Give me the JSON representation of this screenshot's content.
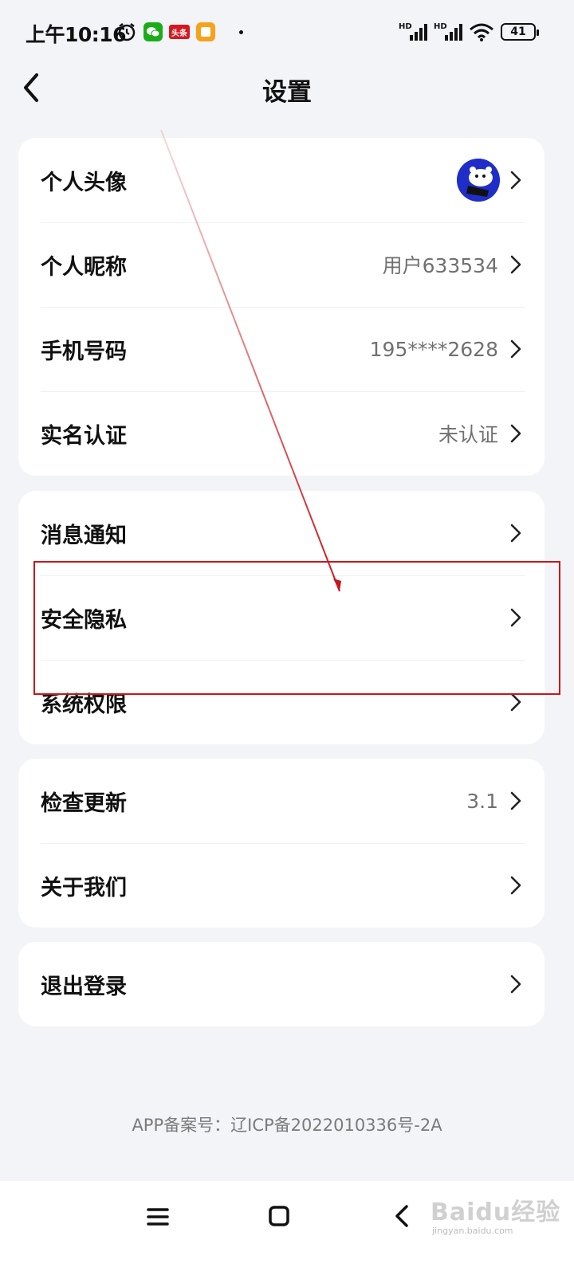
{
  "status_bar": {
    "time": "上午10:16",
    "toutiao_label": "头条",
    "battery": "41",
    "signal_label": "HD"
  },
  "nav": {
    "title": "设置"
  },
  "groups": [
    {
      "rows": [
        {
          "label": "个人头像",
          "value": ""
        },
        {
          "label": "个人昵称",
          "value": "用户633534"
        },
        {
          "label": "手机号码",
          "value": "195****2628"
        },
        {
          "label": "实名认证",
          "value": "未认证"
        }
      ]
    },
    {
      "rows": [
        {
          "label": "消息通知",
          "value": ""
        },
        {
          "label": "安全隐私",
          "value": ""
        },
        {
          "label": "系统权限",
          "value": ""
        }
      ]
    },
    {
      "rows": [
        {
          "label": "检查更新",
          "value": "3.1"
        },
        {
          "label": "关于我们",
          "value": ""
        }
      ]
    },
    {
      "rows": [
        {
          "label": "退出登录",
          "value": ""
        }
      ]
    }
  ],
  "footer": {
    "icp": "APP备案号：辽ICP备2022010336号-2A"
  },
  "watermark": {
    "main": "Baidu经验",
    "sub": "jingyan.baidu.com"
  },
  "colors": {
    "background": "#f3f4f8",
    "card": "#ffffff",
    "annotation": "#c8161a",
    "avatar": "#1f2ec8"
  }
}
